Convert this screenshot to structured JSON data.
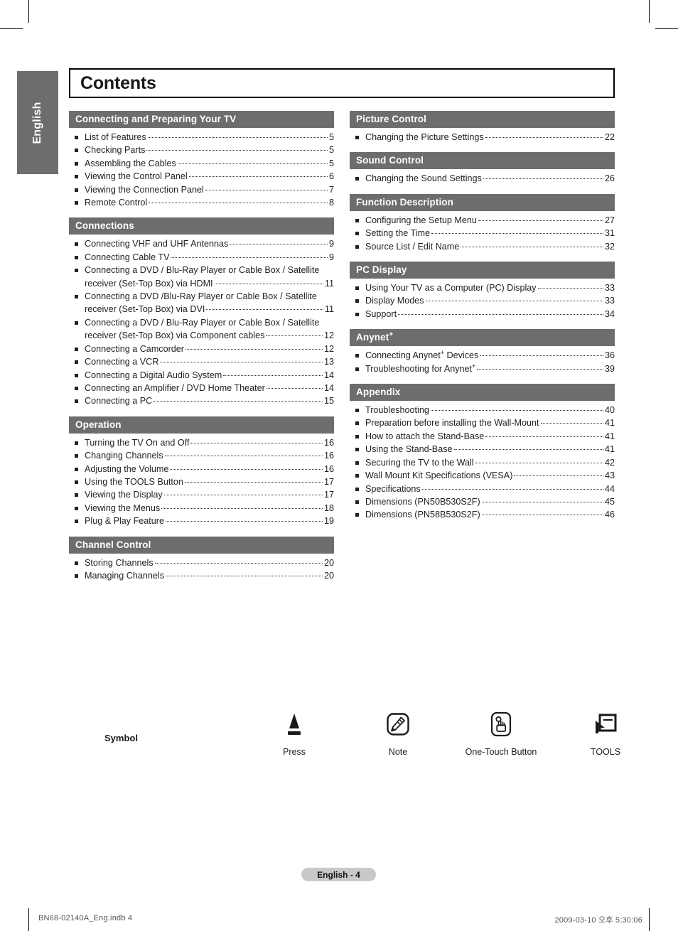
{
  "language_tab": "English",
  "page_title": "Contents",
  "left_column": [
    {
      "heading": "Connecting and Preparing Your TV",
      "entries": [
        {
          "text": "List of Features",
          "page": "5"
        },
        {
          "text": "Checking Parts",
          "page": "5"
        },
        {
          "text": "Assembling the Cables",
          "page": "5"
        },
        {
          "text": "Viewing the Control Panel",
          "page": "6"
        },
        {
          "text": "Viewing the Connection Panel",
          "page": "7"
        },
        {
          "text": "Remote Control",
          "page": "8"
        }
      ]
    },
    {
      "heading": "Connections",
      "entries": [
        {
          "text": "Connecting VHF and UHF Antennas",
          "page": "9"
        },
        {
          "text": "Connecting Cable TV",
          "page": "9"
        },
        {
          "text": "Connecting a DVD / Blu-Ray Player or Cable Box / Satellite",
          "text2": "receiver (Set-Top Box) via HDMI",
          "page": "11"
        },
        {
          "text": "Connecting a DVD /Blu-Ray Player or Cable Box / Satellite",
          "text2": "receiver (Set-Top Box) via DVI",
          "page": "11"
        },
        {
          "text": "Connecting a DVD / Blu-Ray Player or Cable Box / Satellite",
          "text2": "receiver (Set-Top Box) via Component cables",
          "page": "12"
        },
        {
          "text": "Connecting a Camcorder",
          "page": "12"
        },
        {
          "text": "Connecting a VCR",
          "page": "13"
        },
        {
          "text": "Connecting a Digital Audio System",
          "page": "14"
        },
        {
          "text": "Connecting an Amplifier / DVD Home Theater",
          "page": "14"
        },
        {
          "text": "Connecting a PC",
          "page": "15"
        }
      ]
    },
    {
      "heading": "Operation",
      "entries": [
        {
          "text": "Turning the TV On and Off",
          "page": "16"
        },
        {
          "text": "Changing Channels",
          "page": "16"
        },
        {
          "text": "Adjusting the Volume",
          "page": "16"
        },
        {
          "text": "Using the TOOLS Button",
          "page": "17"
        },
        {
          "text": "Viewing the Display",
          "page": "17"
        },
        {
          "text": "Viewing the Menus",
          "page": "18"
        },
        {
          "text": "Plug & Play Feature",
          "page": "19"
        }
      ]
    },
    {
      "heading": "Channel Control",
      "entries": [
        {
          "text": "Storing Channels",
          "page": "20"
        },
        {
          "text": "Managing Channels",
          "page": "20"
        }
      ]
    }
  ],
  "right_column": [
    {
      "heading": "Picture Control",
      "entries": [
        {
          "text": "Changing the Picture Settings",
          "page": "22"
        }
      ]
    },
    {
      "heading": "Sound Control",
      "entries": [
        {
          "text": "Changing the Sound Settings",
          "page": "26"
        }
      ]
    },
    {
      "heading": "Function Description",
      "entries": [
        {
          "text": "Configuring the Setup Menu",
          "page": "27"
        },
        {
          "text": "Setting the Time",
          "page": "31"
        },
        {
          "text": "Source List / Edit Name",
          "page": "32"
        }
      ]
    },
    {
      "heading": "PC Display",
      "entries": [
        {
          "text": "Using Your TV as a Computer (PC) Display",
          "page": "33"
        },
        {
          "text": "Display Modes",
          "page": "33"
        },
        {
          "text": "Support",
          "page": "34"
        }
      ]
    },
    {
      "heading": "Anynet+",
      "heading_sup": true,
      "entries": [
        {
          "text": "Connecting Anynet+ Devices",
          "page": "36",
          "sup": true
        },
        {
          "text": "Troubleshooting for Anynet+",
          "page": "39",
          "sup": true
        }
      ]
    },
    {
      "heading": "Appendix",
      "entries": [
        {
          "text": "Troubleshooting",
          "page": "40"
        },
        {
          "text": "Preparation before installing the Wall-Mount",
          "page": "41"
        },
        {
          "text": "How to attach the Stand-Base",
          "page": "41"
        },
        {
          "text": "Using the Stand-Base",
          "page": "41"
        },
        {
          "text": "Securing the TV to the Wall",
          "page": "42"
        },
        {
          "text": "Wall Mount Kit Specifications (VESA)",
          "page": "43"
        },
        {
          "text": "Specifications",
          "page": "44"
        },
        {
          "text": "Dimensions (PN50B530S2F)",
          "page": "45"
        },
        {
          "text": "Dimensions (PN58B530S2F)",
          "page": "46"
        }
      ]
    }
  ],
  "legend": {
    "label": "Symbol",
    "symbols": [
      {
        "icon": "press-triangle-icon",
        "caption": "Press"
      },
      {
        "icon": "note-pencil-icon",
        "caption": "Note"
      },
      {
        "icon": "one-touch-button-icon",
        "caption": "One-Touch Button"
      },
      {
        "icon": "tools-cursor-icon",
        "caption": "TOOLS"
      }
    ]
  },
  "footer": {
    "page_pill": "English - 4",
    "print_left": "BN68-02140A_Eng.indb   4",
    "print_right": "2009-03-10   오후 5:30:06"
  },
  "colors": {
    "section_header_bg": "#6d6d6d",
    "page_pill_bg": "#c9c9c9",
    "text": "#222222"
  }
}
